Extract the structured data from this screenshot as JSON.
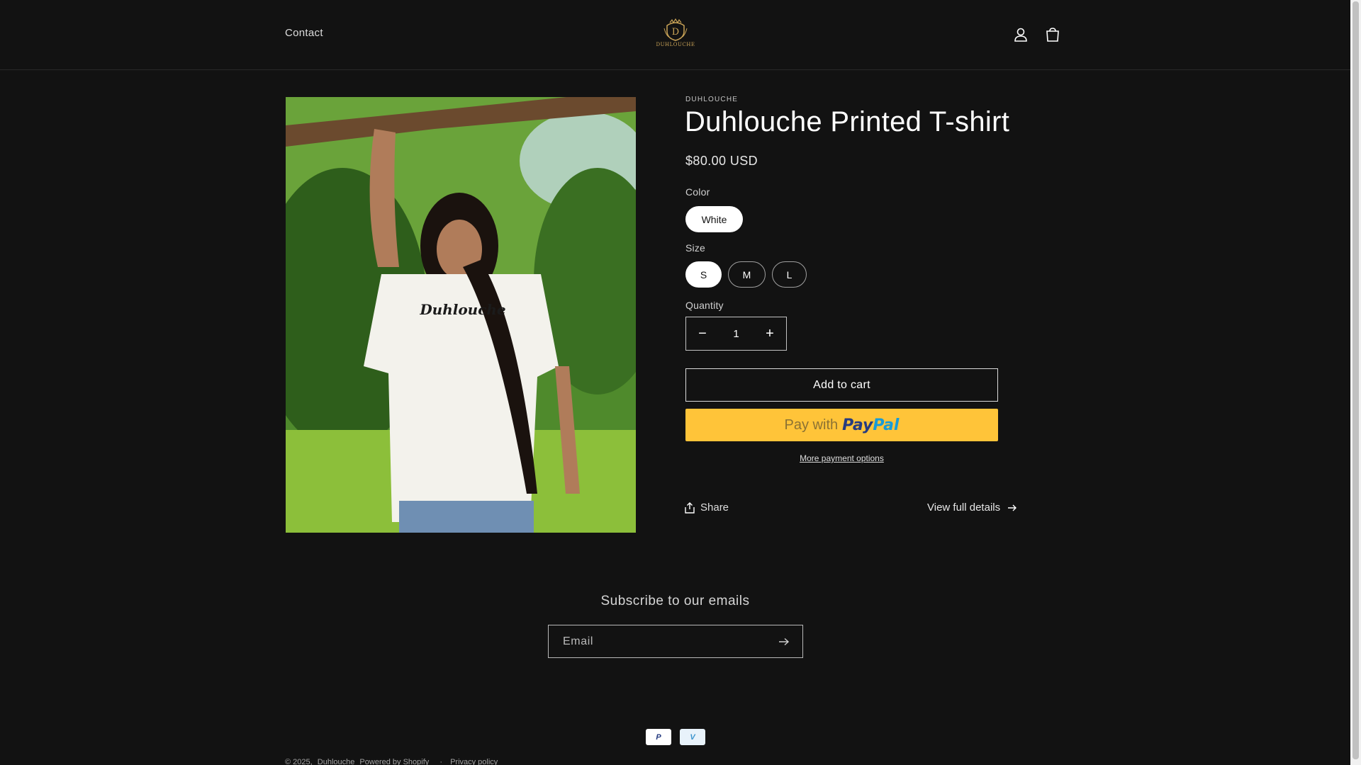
{
  "header": {
    "nav": {
      "contact_label": "Contact"
    },
    "logo": {
      "text": "DUHLOUCHE",
      "monogram": "D",
      "color": "#c9a357"
    },
    "icons": {
      "account": "account-icon",
      "cart": "cart-icon"
    }
  },
  "product": {
    "vendor": "DUHLOUCHE",
    "title": "Duhlouche Printed T-shirt",
    "price": "$80.00 USD",
    "shirt_print": "Duhlouche",
    "color": {
      "label": "Color",
      "options": [
        "White"
      ],
      "selected": "White"
    },
    "size": {
      "label": "Size",
      "options": [
        "S",
        "M",
        "L"
      ],
      "selected": "S"
    },
    "quantity": {
      "label": "Quantity",
      "value": "1",
      "minus": "−",
      "plus": "+"
    },
    "add_to_cart_label": "Add to cart",
    "paypal": {
      "pay_with": "Pay with",
      "brand_part1": "Pay",
      "brand_part2": "Pal",
      "bg_color": "#ffc439"
    },
    "more_payment_label": "More payment options",
    "share_label": "Share",
    "view_details_label": "View full details"
  },
  "newsletter": {
    "title": "Subscribe to our emails",
    "email_placeholder": "Email"
  },
  "footer": {
    "payment_icons": [
      {
        "name": "paypal",
        "label": "P"
      },
      {
        "name": "venmo",
        "label": "V"
      }
    ],
    "copyright": "© 2025,",
    "store_link": "Duhlouche",
    "powered": "Powered by Shopify",
    "separator": "·",
    "privacy": "Privacy policy"
  },
  "colors": {
    "background": "#121212",
    "text": "#ffffff",
    "paypal_yellow": "#ffc439"
  }
}
